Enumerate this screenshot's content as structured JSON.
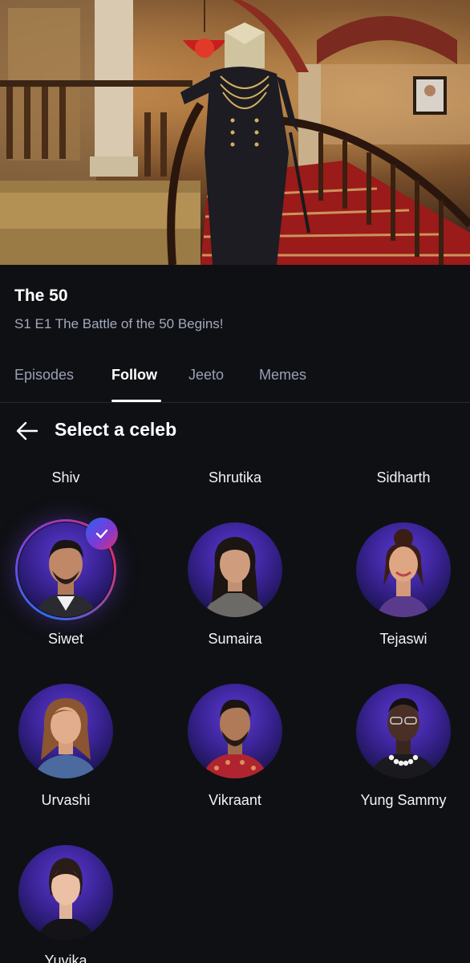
{
  "show": {
    "title": "The 50",
    "episode": "S1 E1 The Battle of the 50 Begins!"
  },
  "tabs": [
    {
      "label": "Episodes",
      "active": false
    },
    {
      "label": "Follow",
      "active": true
    },
    {
      "label": "Jeeto",
      "active": false
    },
    {
      "label": "Memes",
      "active": false
    }
  ],
  "section": {
    "title": "Select a celeb",
    "back_icon": "arrow-left-icon"
  },
  "celebs_top_row_partial": [
    "Shiv",
    "Shrutika",
    "Sidharth"
  ],
  "celebs": [
    {
      "name": "Siwet",
      "selected": true
    },
    {
      "name": "Sumaira",
      "selected": false
    },
    {
      "name": "Tejaswi",
      "selected": false
    },
    {
      "name": "Urvashi",
      "selected": false
    },
    {
      "name": "Vikraant",
      "selected": false
    },
    {
      "name": "Yung Sammy",
      "selected": false
    },
    {
      "name": "Yuvika",
      "selected": false
    }
  ],
  "colors": {
    "background": "#0f1014",
    "accent_blue": "#2c63f0",
    "accent_pink": "#e0306f",
    "avatar_purple": "#3a2394"
  }
}
